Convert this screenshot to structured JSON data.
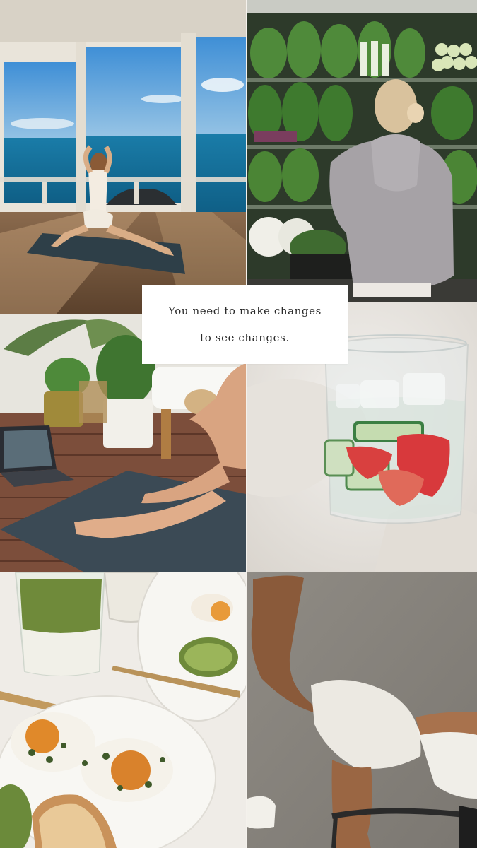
{
  "quote": {
    "line1": "You need to make changes",
    "line2": "to see changes."
  }
}
